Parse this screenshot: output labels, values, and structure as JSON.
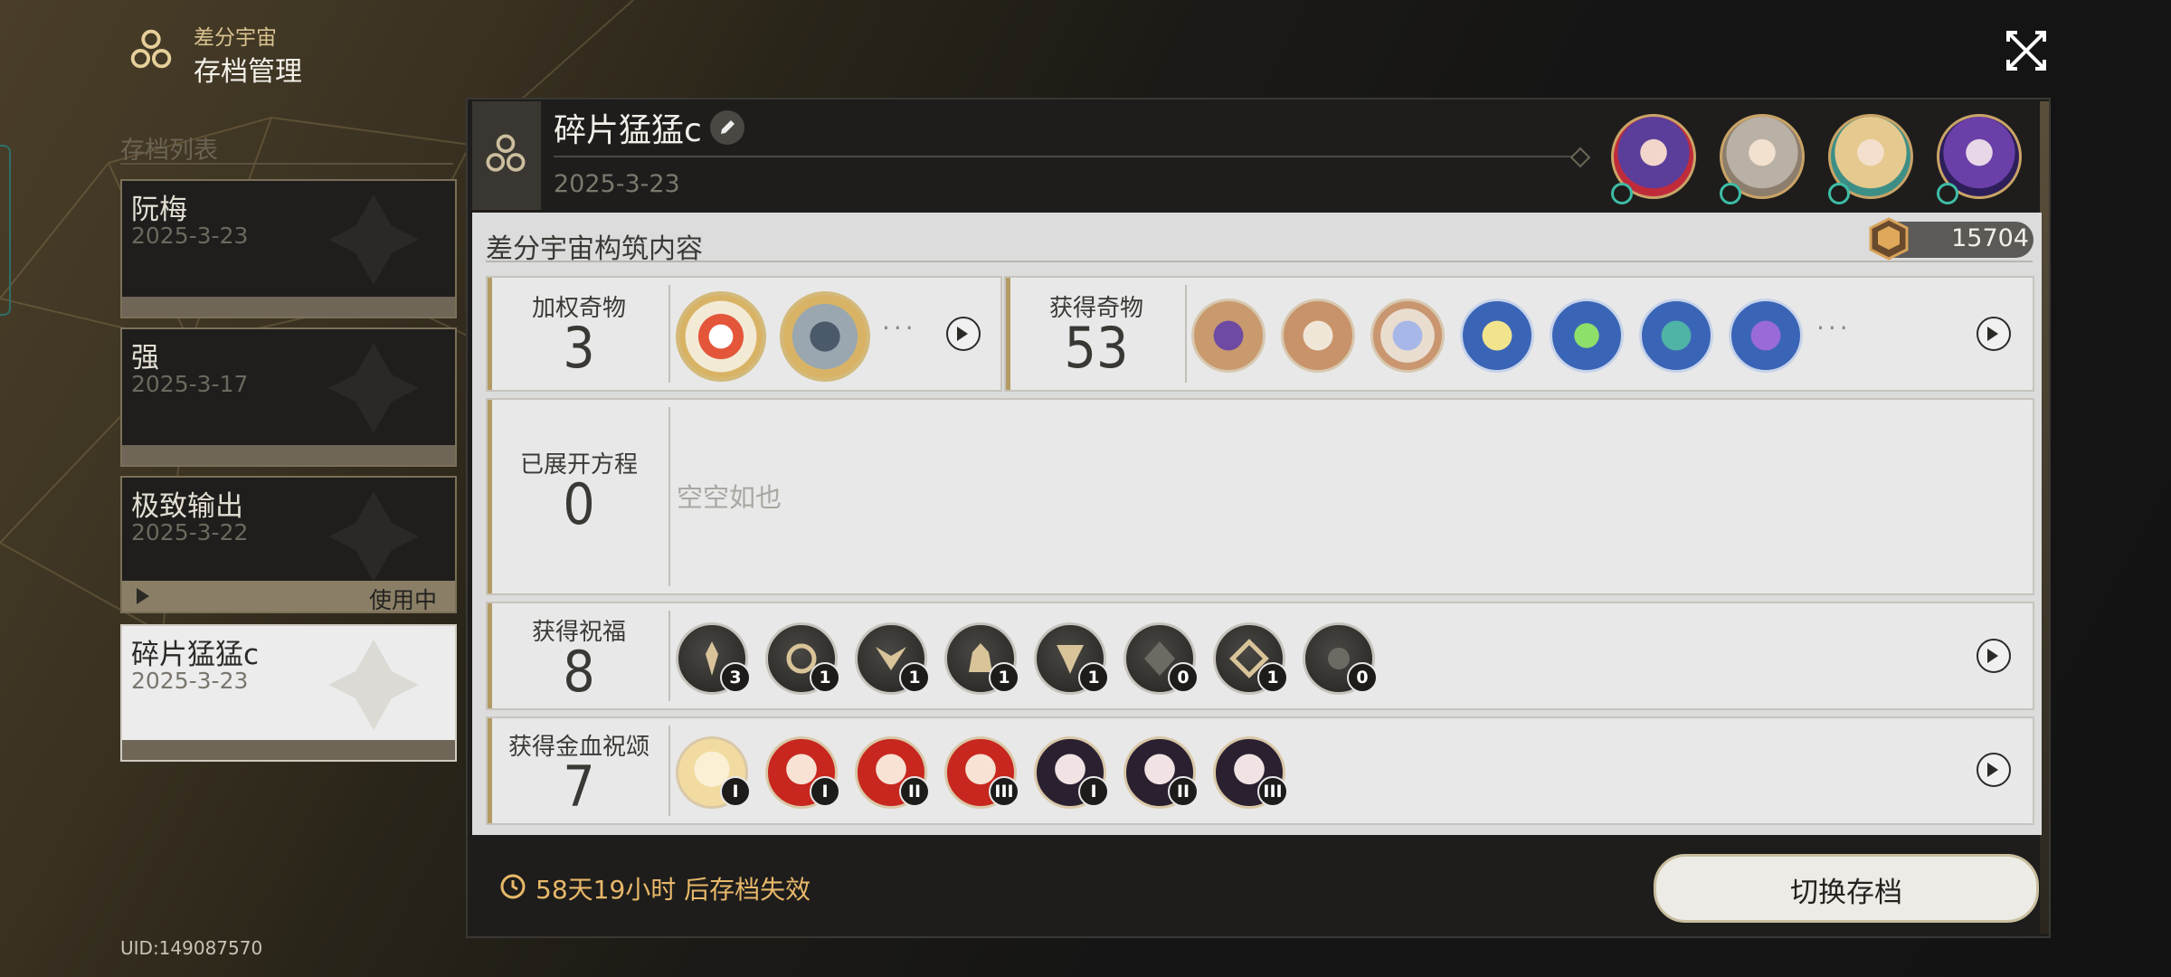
{
  "app": {
    "subtitle": "差分宇宙",
    "title": "存档管理"
  },
  "list": {
    "title": "存档列表",
    "saves": [
      {
        "name": "阮梅",
        "date": "2025-3-23"
      },
      {
        "name": "强",
        "date": "2025-3-17"
      },
      {
        "name": "极致输出",
        "date": "2025-3-22",
        "status": "使用中"
      },
      {
        "name": "碎片猛猛c",
        "date": "2025-3-23"
      }
    ]
  },
  "uid": "UID:149087570",
  "detail": {
    "name": "碎片猛猛c",
    "date": "2025-3-23",
    "section_title": "差分宇宙构筑内容",
    "currency": "15704",
    "weighted_curios": {
      "label": "加权奇物",
      "count": "3"
    },
    "obtained_curios": {
      "label": "获得奇物",
      "count": "53"
    },
    "equations": {
      "label": "已展开方程",
      "count": "0",
      "empty_text": "空空如也"
    },
    "blessings": {
      "label": "获得祝福",
      "count": "8",
      "items": [
        "3",
        "1",
        "1",
        "1",
        "1",
        "0",
        "1",
        "0"
      ]
    },
    "golden_blood": {
      "label": "获得金血祝颂",
      "count": "7",
      "items": [
        "I",
        "I",
        "II",
        "III",
        "I",
        "II",
        "III"
      ]
    },
    "more_dots": "···"
  },
  "footer": {
    "expire_text": "58天19小时 后存档失效",
    "switch_label": "切换存档"
  },
  "colors": {
    "accent_gold": "#e8b86a",
    "badge_teal": "#3dbda6"
  }
}
